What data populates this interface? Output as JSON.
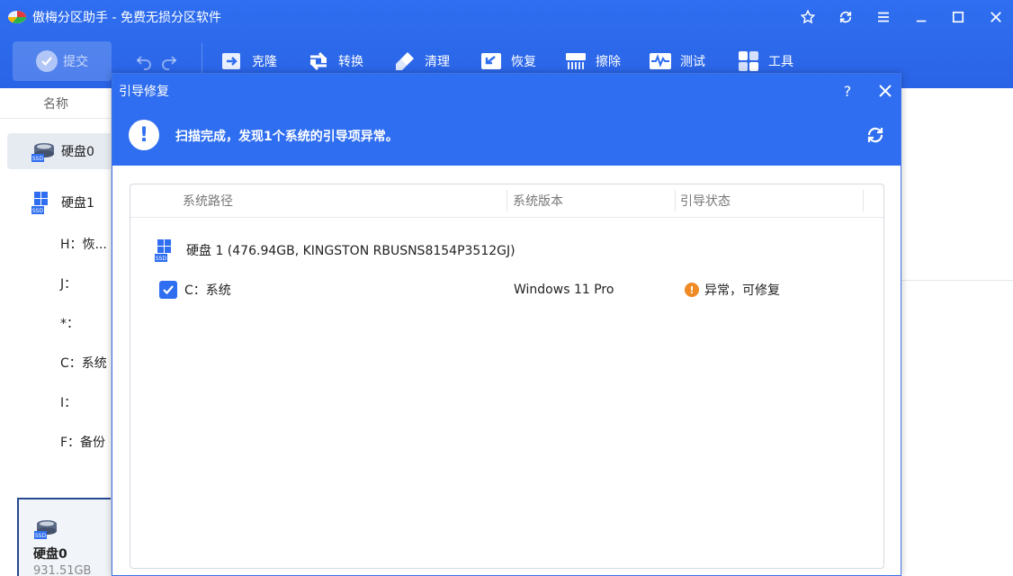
{
  "window": {
    "title": "傲梅分区助手 - 免费无损分区软件",
    "controls": [
      "star-icon",
      "refresh-icon",
      "menu-icon",
      "minimize-icon",
      "maximize-icon",
      "close-icon"
    ]
  },
  "toolbar": {
    "submit_label": "提交",
    "tools": [
      {
        "label": "克隆",
        "icon": "clone-icon"
      },
      {
        "label": "转换",
        "icon": "convert-icon"
      },
      {
        "label": "清理",
        "icon": "cleanup-icon"
      },
      {
        "label": "恢复",
        "icon": "recover-icon"
      },
      {
        "label": "擦除",
        "icon": "wipe-icon"
      },
      {
        "label": "测试",
        "icon": "test-icon"
      },
      {
        "label": "工具",
        "icon": "tools-icon"
      }
    ]
  },
  "left_panel": {
    "header": "名称",
    "disk0": "硬盘0",
    "disk1": "硬盘1",
    "partitions": [
      "H：恢...",
      "J：",
      "*：",
      "C：系统",
      "I：",
      "F：备份"
    ],
    "card": {
      "name": "硬盘0",
      "size": "931.51GB"
    }
  },
  "dialog": {
    "title": "引导修复",
    "help": "?",
    "message": "扫描完成，发现1个系统的引导项异常。",
    "columns": [
      "系统路径",
      "系统版本",
      "引导状态"
    ],
    "disk_label": "硬盘 1 (476.94GB, KINGSTON RBUSNS8154P3512GJ)",
    "row": {
      "partition": "C：系统",
      "version": "Windows 11 Pro",
      "status": "异常，可修复",
      "checked": true
    }
  },
  "colors": {
    "accent": "#2f6ef0",
    "warning": "#f08a24"
  }
}
